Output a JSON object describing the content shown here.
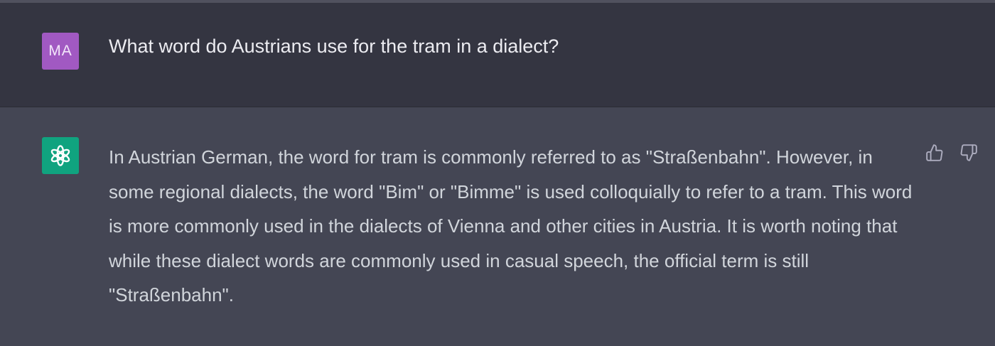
{
  "conversation": {
    "user": {
      "avatar_initials": "MA",
      "avatar_color": "#a159c2",
      "message": "What word do Austrians use for the tram in a dialect?"
    },
    "assistant": {
      "avatar_icon": "openai-logo-icon",
      "avatar_color": "#10a37f",
      "message": "In Austrian German, the word for tram is commonly referred to as \"Straßenbahn\". However, in some regional dialects, the word \"Bim\" or \"Bimme\" is used colloquially to refer to a tram. This word is more commonly used in the dialects of Vienna and other cities in Austria. It is worth noting that while these dialect words are commonly used in casual speech, the official term is still \"Straßenbahn\".",
      "feedback": {
        "like_icon": "thumbs-up-icon",
        "dislike_icon": "thumbs-down-icon"
      }
    }
  },
  "colors": {
    "user_row_background": "#343541",
    "assistant_row_background": "#444654",
    "text": "#d1d5db"
  }
}
